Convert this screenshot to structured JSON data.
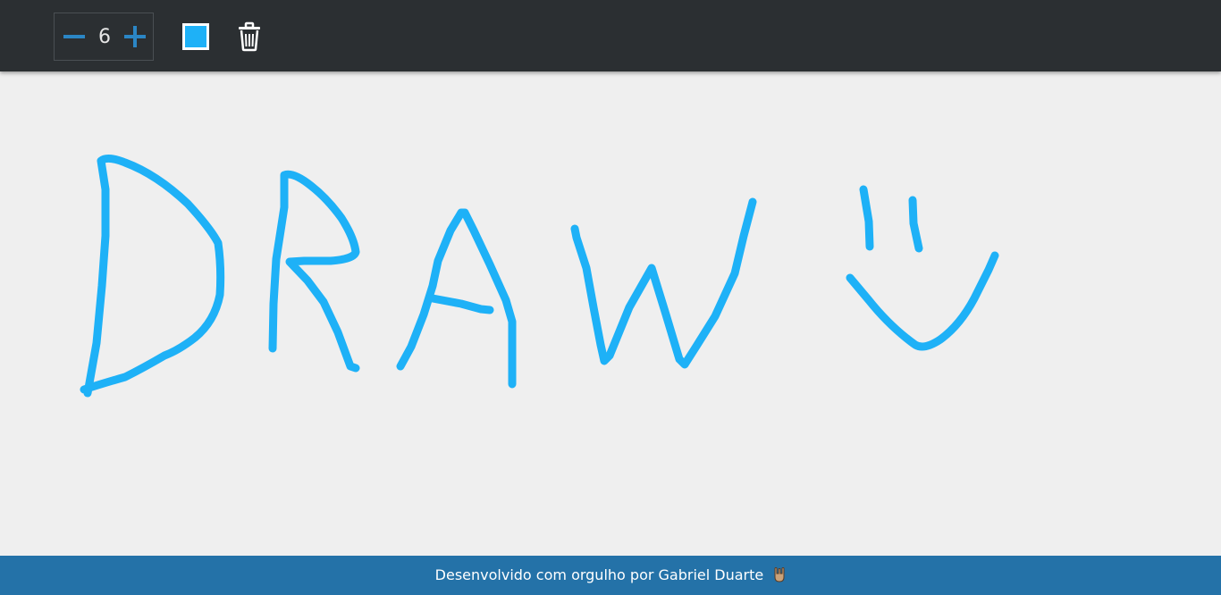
{
  "toolbar": {
    "stroke_size": "6",
    "colors": {
      "background": "#2b2f32",
      "stepper_icon": "#2b86c5",
      "selected_color": "#1eb1f7"
    },
    "icons": {
      "decrease": "minus-icon",
      "increase": "plus-icon",
      "clear": "trash-icon"
    }
  },
  "canvas": {
    "background": "#efefef",
    "stroke_color": "#1eb1f7",
    "stroke_width": 6
  },
  "footer": {
    "text": "Desenvolvido com orgulho por Gabriel Duarte",
    "icon": "rock-hand-icon",
    "background": "#2472a8"
  }
}
